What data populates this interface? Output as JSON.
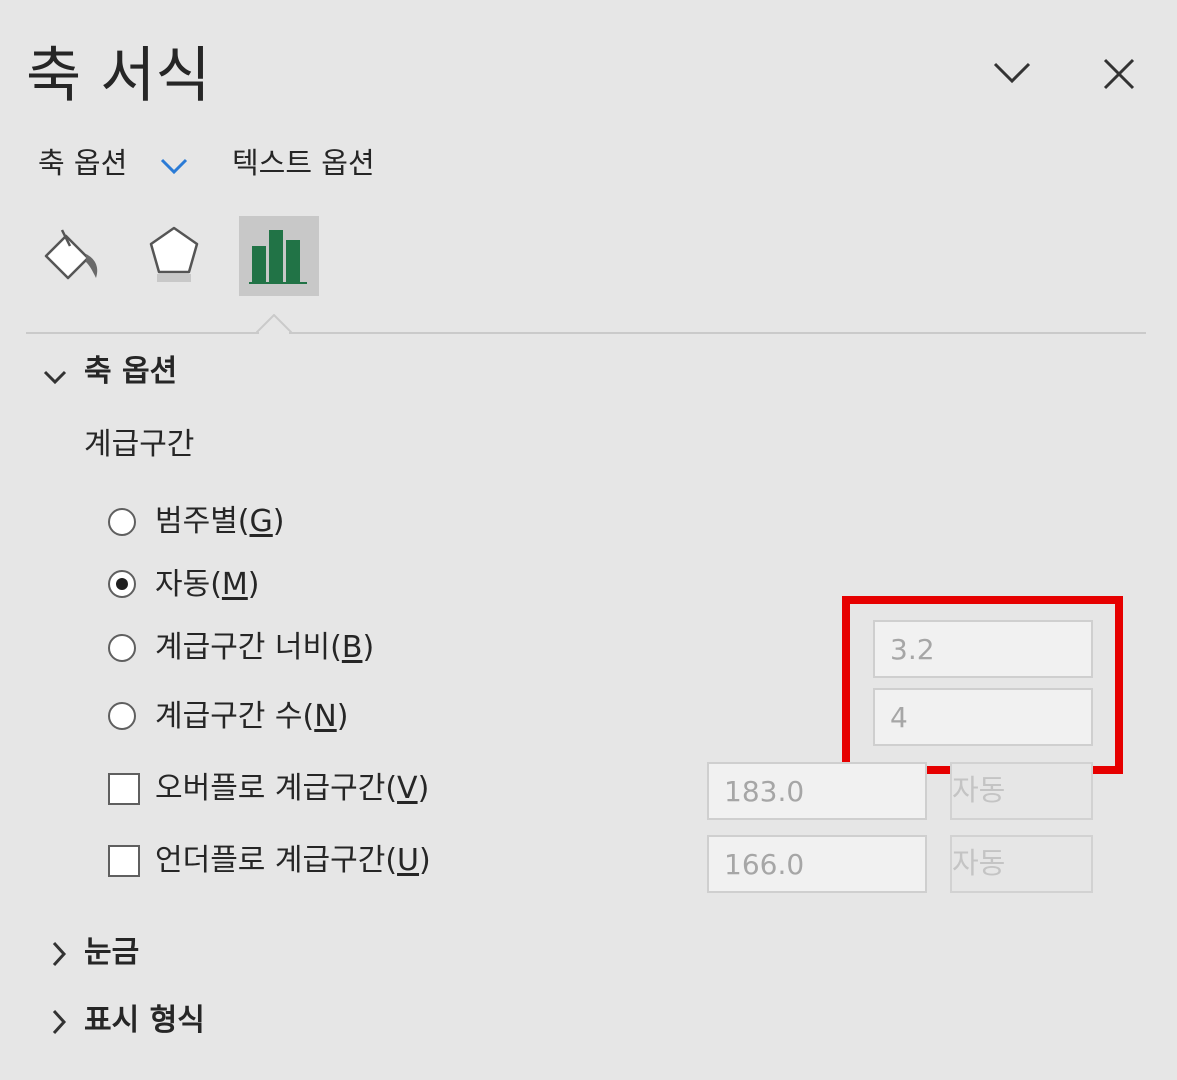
{
  "pane": {
    "title": "축 서식",
    "collapse_icon": "chevron-down-icon",
    "close_icon": "close-icon"
  },
  "tabs": [
    {
      "label": "축 옵션",
      "active": true
    },
    {
      "label": "텍스트 옵션",
      "active": false
    }
  ],
  "icon_tabs": [
    {
      "name": "fill-line-icon",
      "active": false
    },
    {
      "name": "effects-pentagon-icon",
      "active": false
    },
    {
      "name": "axis-options-bar-chart-icon",
      "active": true,
      "color": "#217346"
    }
  ],
  "axis_options_section": {
    "title": "축 옵션",
    "expanded": true,
    "bins_label": "계급구간",
    "radios": [
      {
        "label_pre": "범주별(",
        "accel": "G",
        "label_post": ")",
        "checked": false
      },
      {
        "label_pre": "자동(",
        "accel": "M",
        "label_post": ")",
        "checked": true
      },
      {
        "label_pre": "계급구간 너비(",
        "accel": "B",
        "label_post": ")",
        "checked": false,
        "value": "3.2"
      },
      {
        "label_pre": "계급구간 수(",
        "accel": "N",
        "label_post": ")",
        "checked": false,
        "value": "4"
      }
    ],
    "checkboxes": [
      {
        "label_pre": "오버플로 계급구간(",
        "accel": "V",
        "label_post": ")",
        "checked": false,
        "value": "183.0",
        "auto_label": "자동"
      },
      {
        "label_pre": "언더플로 계급구간(",
        "accel": "U",
        "label_post": ")",
        "checked": false,
        "value": "166.0",
        "auto_label": "자동"
      }
    ]
  },
  "collapsed_sections": [
    {
      "title": "눈금",
      "expanded": false
    },
    {
      "title": "표시 형식",
      "expanded": false
    }
  ],
  "highlight_color": "#e60000"
}
